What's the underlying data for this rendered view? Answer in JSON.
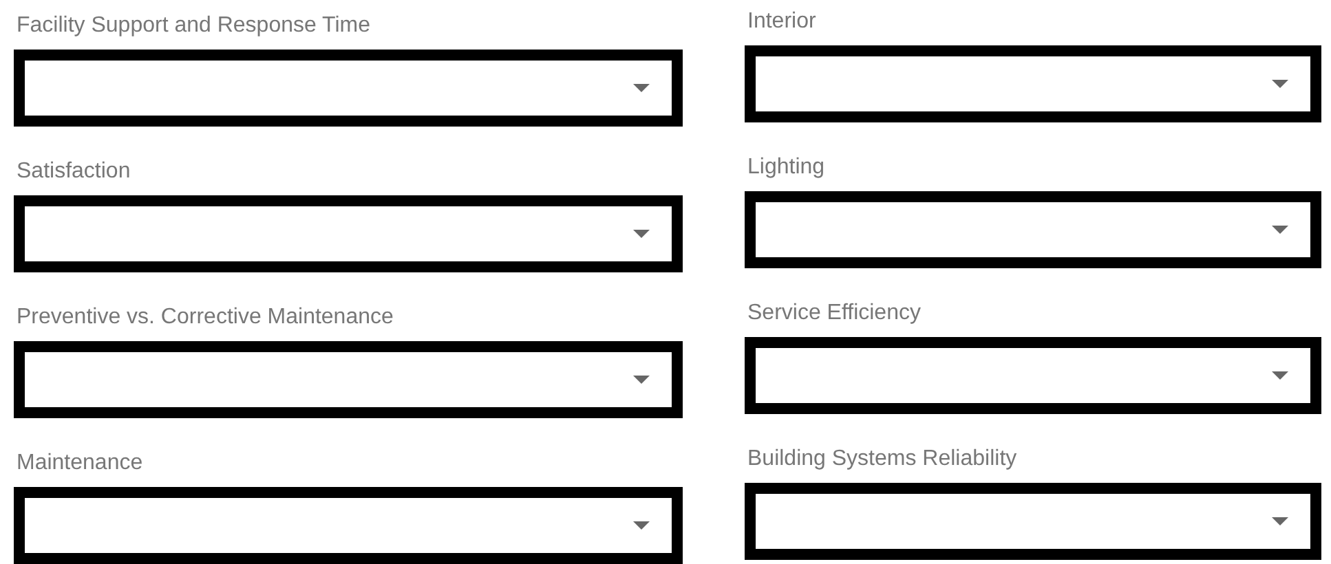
{
  "fields": [
    {
      "label": "Facility Support and Response Time"
    },
    {
      "label": "Interior"
    },
    {
      "label": "Satisfaction"
    },
    {
      "label": "Lighting"
    },
    {
      "label": "Preventive vs. Corrective Maintenance"
    },
    {
      "label": "Service Efficiency"
    },
    {
      "label": "Maintenance"
    },
    {
      "label": "Building Systems Reliability"
    }
  ]
}
